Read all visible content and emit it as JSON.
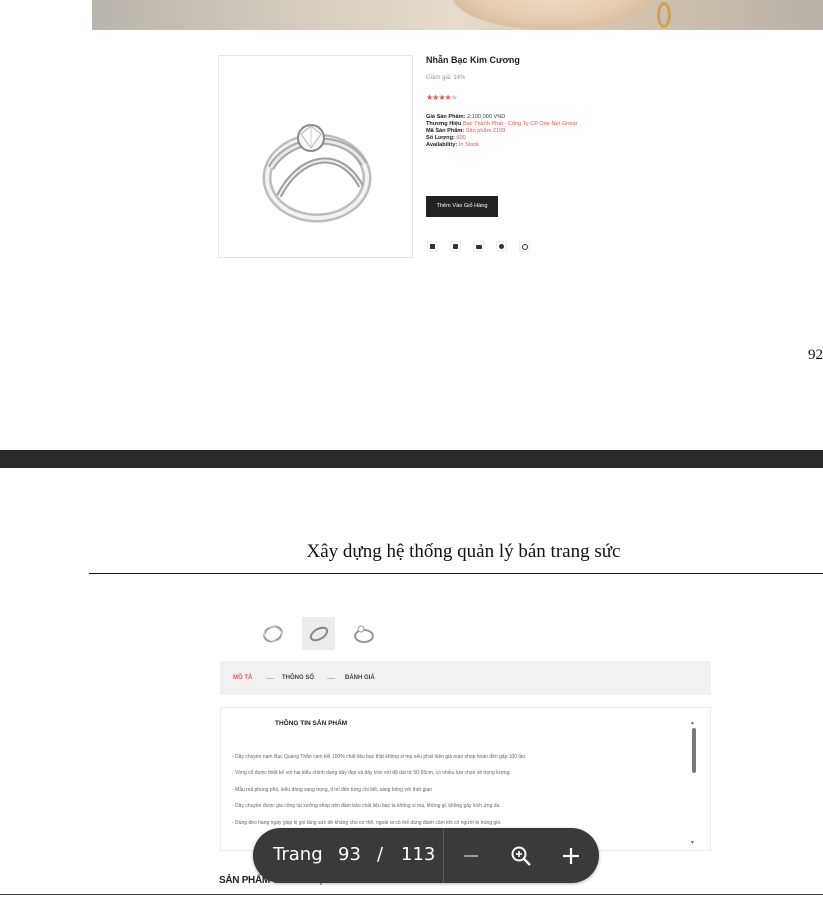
{
  "product": {
    "title": "Nhẫn Bạc Kim Cương",
    "discount": "Giảm giá: 14%",
    "rating": 4,
    "rating_max": 5,
    "fields": [
      {
        "label": "Giá Sản Phẩm:",
        "value": "2,100,000 VND",
        "style": "plain"
      },
      {
        "label": "Thương Hiệu",
        "value": "Bạc Thành Phát - Công Ty CP One Net Group",
        "style": "red"
      },
      {
        "label": "Mã Sản Phẩm:",
        "value": "Sản phẩm 2109",
        "style": "red"
      },
      {
        "label": "Số Lượng:",
        "value": "600",
        "style": "red"
      },
      {
        "label": "Availability:",
        "value": "In Stock",
        "style": "red"
      }
    ],
    "add_to_cart": "Thêm Vào Giỏ Hàng",
    "share_icons": [
      "facebook-icon",
      "twitter-icon",
      "youtube-icon",
      "dribbble-icon",
      "instagram-icon"
    ]
  },
  "previous_page_number": "92",
  "document": {
    "header": "Xây dựng hệ thống quản lý bán trang sức"
  },
  "tabs": [
    "MÔ TẢ",
    "THÔNG SỐ",
    "ĐÁNH GIÁ"
  ],
  "description": {
    "title": "THÔNG TIN SẢN PHẨM",
    "lines": [
      "- Dây chuyền nam Bạc Quang Thắn cam kết 100% chất liệu bạc thật không xi mạ nếu phát hiện giả mạo shop hoàn đền gấp 100 lần.",
      "- Vòng cổ được thiết kế với hai kiểu chính dạng dây đẹp và dây tròn với độ dài từ 50-55cm, có nhiều lựa chọn về trọng lượng.",
      "- Mẫu mã phong phú, kiểu dáng sang trọng, tỉ mỉ đến từng chi tiết, sáng bóng với thời gian",
      "- Dây chuyền được gia công tại xưởng shop nên đảm bảo chất liệu bạc ta không xi mạ, không gỉ, không gây kích ứng da.",
      "- Dùng đeo hàng ngày giúp kị gió tăng sức đề kháng cho cơ thể, ngoài ra có thể dùng đánh cảm khi có người bị trúng gió."
    ]
  },
  "similar_title": "SẢN PHẨM TƯƠNG TỰ",
  "pdf_toolbar": {
    "page_label": "Trang",
    "current_page": "93",
    "separator": "/",
    "total_pages": "113"
  },
  "colors": {
    "accent": "#e8574b",
    "dark": "#222222",
    "toolbar": "#3a3a3a"
  }
}
